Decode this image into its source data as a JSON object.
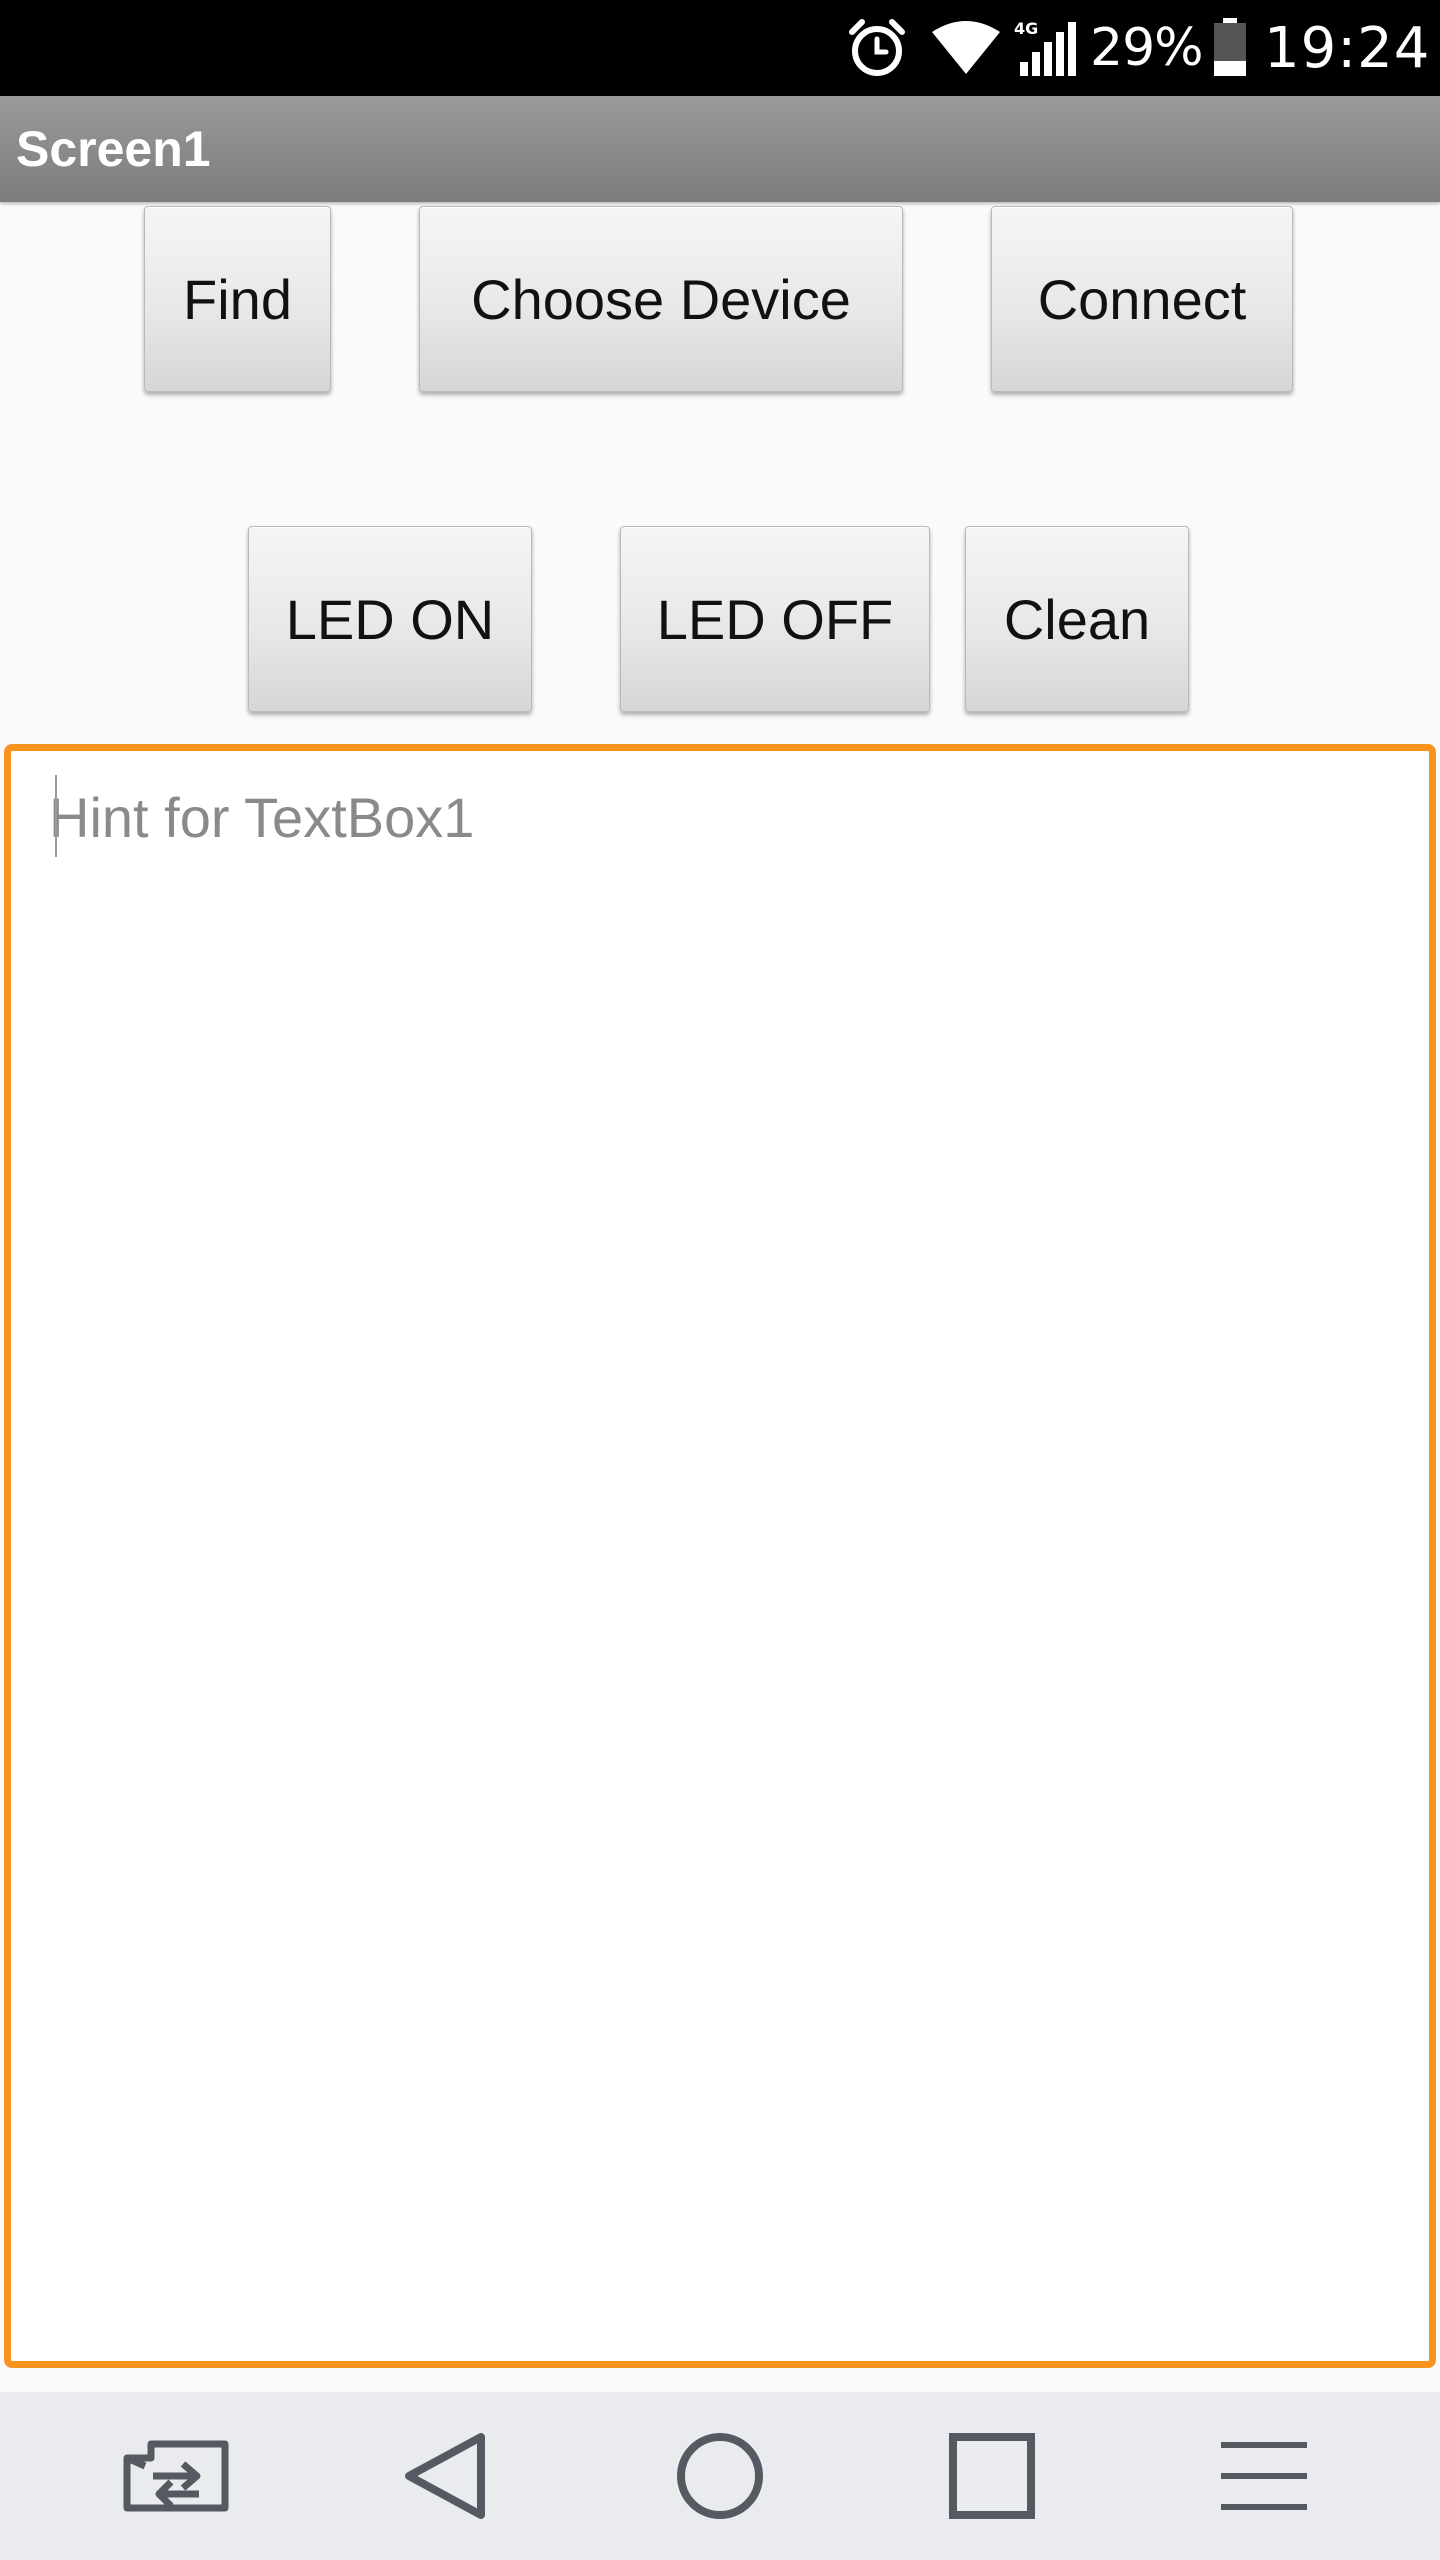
{
  "status_bar": {
    "battery_percent": "29%",
    "time": "19:24",
    "network": "4G",
    "icons": [
      "alarm-icon",
      "wifi-icon",
      "signal-icon",
      "battery-icon"
    ],
    "battery_level": 0.29
  },
  "title_bar": {
    "title": "Screen1"
  },
  "buttons": {
    "find": "Find",
    "choose_device": "Choose Device",
    "connect": "Connect",
    "led_on": "LED ON",
    "led_off": "LED OFF",
    "clean": "Clean"
  },
  "textbox": {
    "value": "",
    "placeholder": "Hint for TextBox1",
    "border_color": "#f7931e"
  },
  "nav_bar": {
    "icons": [
      "switch-app-icon",
      "back-icon",
      "home-icon",
      "recent-apps-icon",
      "menu-icon"
    ]
  },
  "colors": {
    "status_bar_bg": "#000000",
    "title_bar_bg": "#8a8a8a",
    "accent": "#f7931e",
    "nav_bar_bg": "#e9ebef",
    "nav_icon": "#555a62"
  }
}
